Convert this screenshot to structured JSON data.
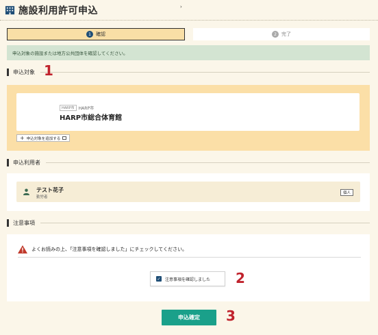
{
  "header": {
    "title": "施設利用許可申込",
    "icon": "building-icon"
  },
  "stepper": {
    "steps": [
      {
        "number": "1",
        "label": "確認",
        "state": "active"
      },
      {
        "number": "2",
        "label": "完了",
        "state": "pending"
      }
    ],
    "separator": "›"
  },
  "info_message": "申込対象の施設または地方公共団体を確認してください。",
  "sections": {
    "target": {
      "heading": "申込対象",
      "facility": {
        "tag": "HARP市",
        "prefecture": "HARP市",
        "name": "HARP市総合体育館"
      },
      "add_button": "申込対象を追加する"
    },
    "applicant": {
      "heading": "申込利用者",
      "user": {
        "name": "テスト花子",
        "role": "勤労者",
        "badge": "個人",
        "icon": "person-icon"
      }
    },
    "notes": {
      "heading": "注意事項",
      "warning": "よくお読みの上、「注意事項を確認しました」にチェックしてください。",
      "checkbox_label": "注意事項を確認しました",
      "checkbox_checked": true
    }
  },
  "submit_label": "申込確定",
  "annotations": [
    "1",
    "2",
    "3"
  ],
  "colors": {
    "background": "#fbf6e9",
    "step_active": "#f9dfa6",
    "info_bg": "#d3e4d2",
    "panel_target": "#fbdfa7",
    "user_card": "#f6edd6",
    "primary_teal": "#1aa08a",
    "navy": "#1f4e76",
    "callout_red": "#c0222c",
    "warning_red": "#c0392b"
  }
}
